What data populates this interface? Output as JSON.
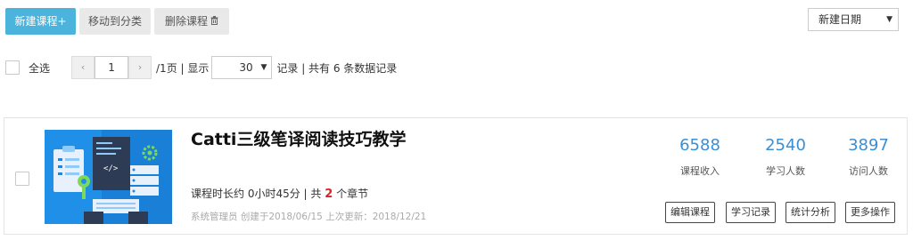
{
  "toolbar": {
    "new_course": "新建课程+",
    "move_category": "移动到分类",
    "delete_course": "删除课程",
    "trash_icon": "trash-icon"
  },
  "sort": {
    "selected": "新建日期",
    "caret": "▼"
  },
  "pager": {
    "select_all": "全选",
    "prev": "‹",
    "next": "›",
    "page": "1",
    "after_page": "/1页 | 显示",
    "page_size": "30",
    "caret": "▼",
    "summary": "记录 | 共有 6 条数据记录"
  },
  "course": {
    "title": "Catti三级笔译阅读技巧教学",
    "duration_prefix": "课程时长约 0小时45分 | 共 ",
    "chapters": "2",
    "duration_suffix": " 个章节",
    "meta": "系统管理员 创建于2018/06/15 上次更新：2018/12/21",
    "stats": [
      {
        "value": "6588",
        "label": "课程收入"
      },
      {
        "value": "2540",
        "label": "学习人数"
      },
      {
        "value": "3897",
        "label": "访问人数"
      }
    ],
    "actions": [
      "编辑课程",
      "学习记录",
      "统计分析",
      "更多操作"
    ]
  },
  "colors": {
    "accent": "#4bb3dc",
    "stat": "#3a8fd4",
    "highlight": "#e02020"
  }
}
